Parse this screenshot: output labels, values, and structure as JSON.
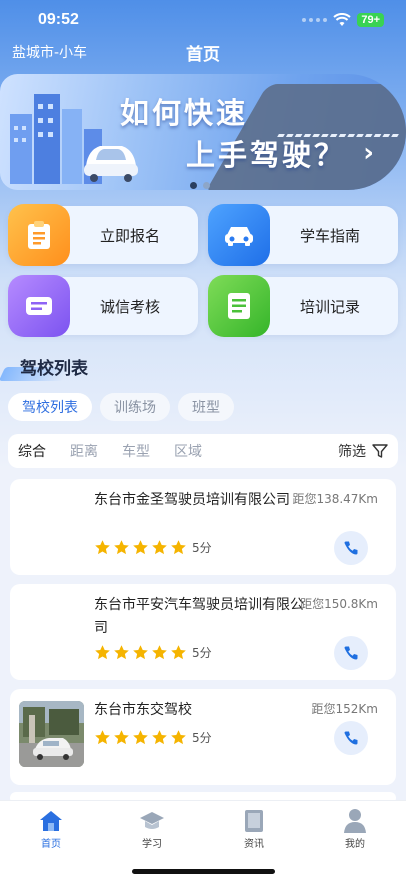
{
  "status": {
    "time": "09:52",
    "battery": "79+"
  },
  "nav": {
    "city": "盐城市-小车",
    "title": "首页"
  },
  "banner": {
    "line1": "如何快速",
    "line2": "上手驾驶？",
    "arrow": "›"
  },
  "quick_actions": [
    {
      "label": "立即报名",
      "icon": "clipboard-icon"
    },
    {
      "label": "学车指南",
      "icon": "car-icon"
    },
    {
      "label": "诚信考核",
      "icon": "ticket-icon"
    },
    {
      "label": "培训记录",
      "icon": "document-icon"
    }
  ],
  "section": {
    "title": "驾校列表"
  },
  "chips": [
    "驾校列表",
    "训练场",
    "班型"
  ],
  "filters": [
    "综合",
    "距离",
    "车型",
    "区域"
  ],
  "filter_screen": "筛选",
  "schools": [
    {
      "name": "东台市金圣驾驶员培训有限公司",
      "distance": "距您138.47Km",
      "score": "5分"
    },
    {
      "name": "东台市平安汽车驾驶员培训有限公司",
      "distance": "距您150.8Km",
      "score": "5分"
    },
    {
      "name": "东台市东交驾校",
      "distance": "距您152Km",
      "score": "5分"
    }
  ],
  "tabs": [
    {
      "label": "首页",
      "icon": "home-icon"
    },
    {
      "label": "学习",
      "icon": "graduation-cap-icon"
    },
    {
      "label": "资讯",
      "icon": "book-icon"
    },
    {
      "label": "我的",
      "icon": "user-icon"
    }
  ],
  "colors": {
    "accent": "#2a6fe0",
    "star": "#f5b400"
  }
}
